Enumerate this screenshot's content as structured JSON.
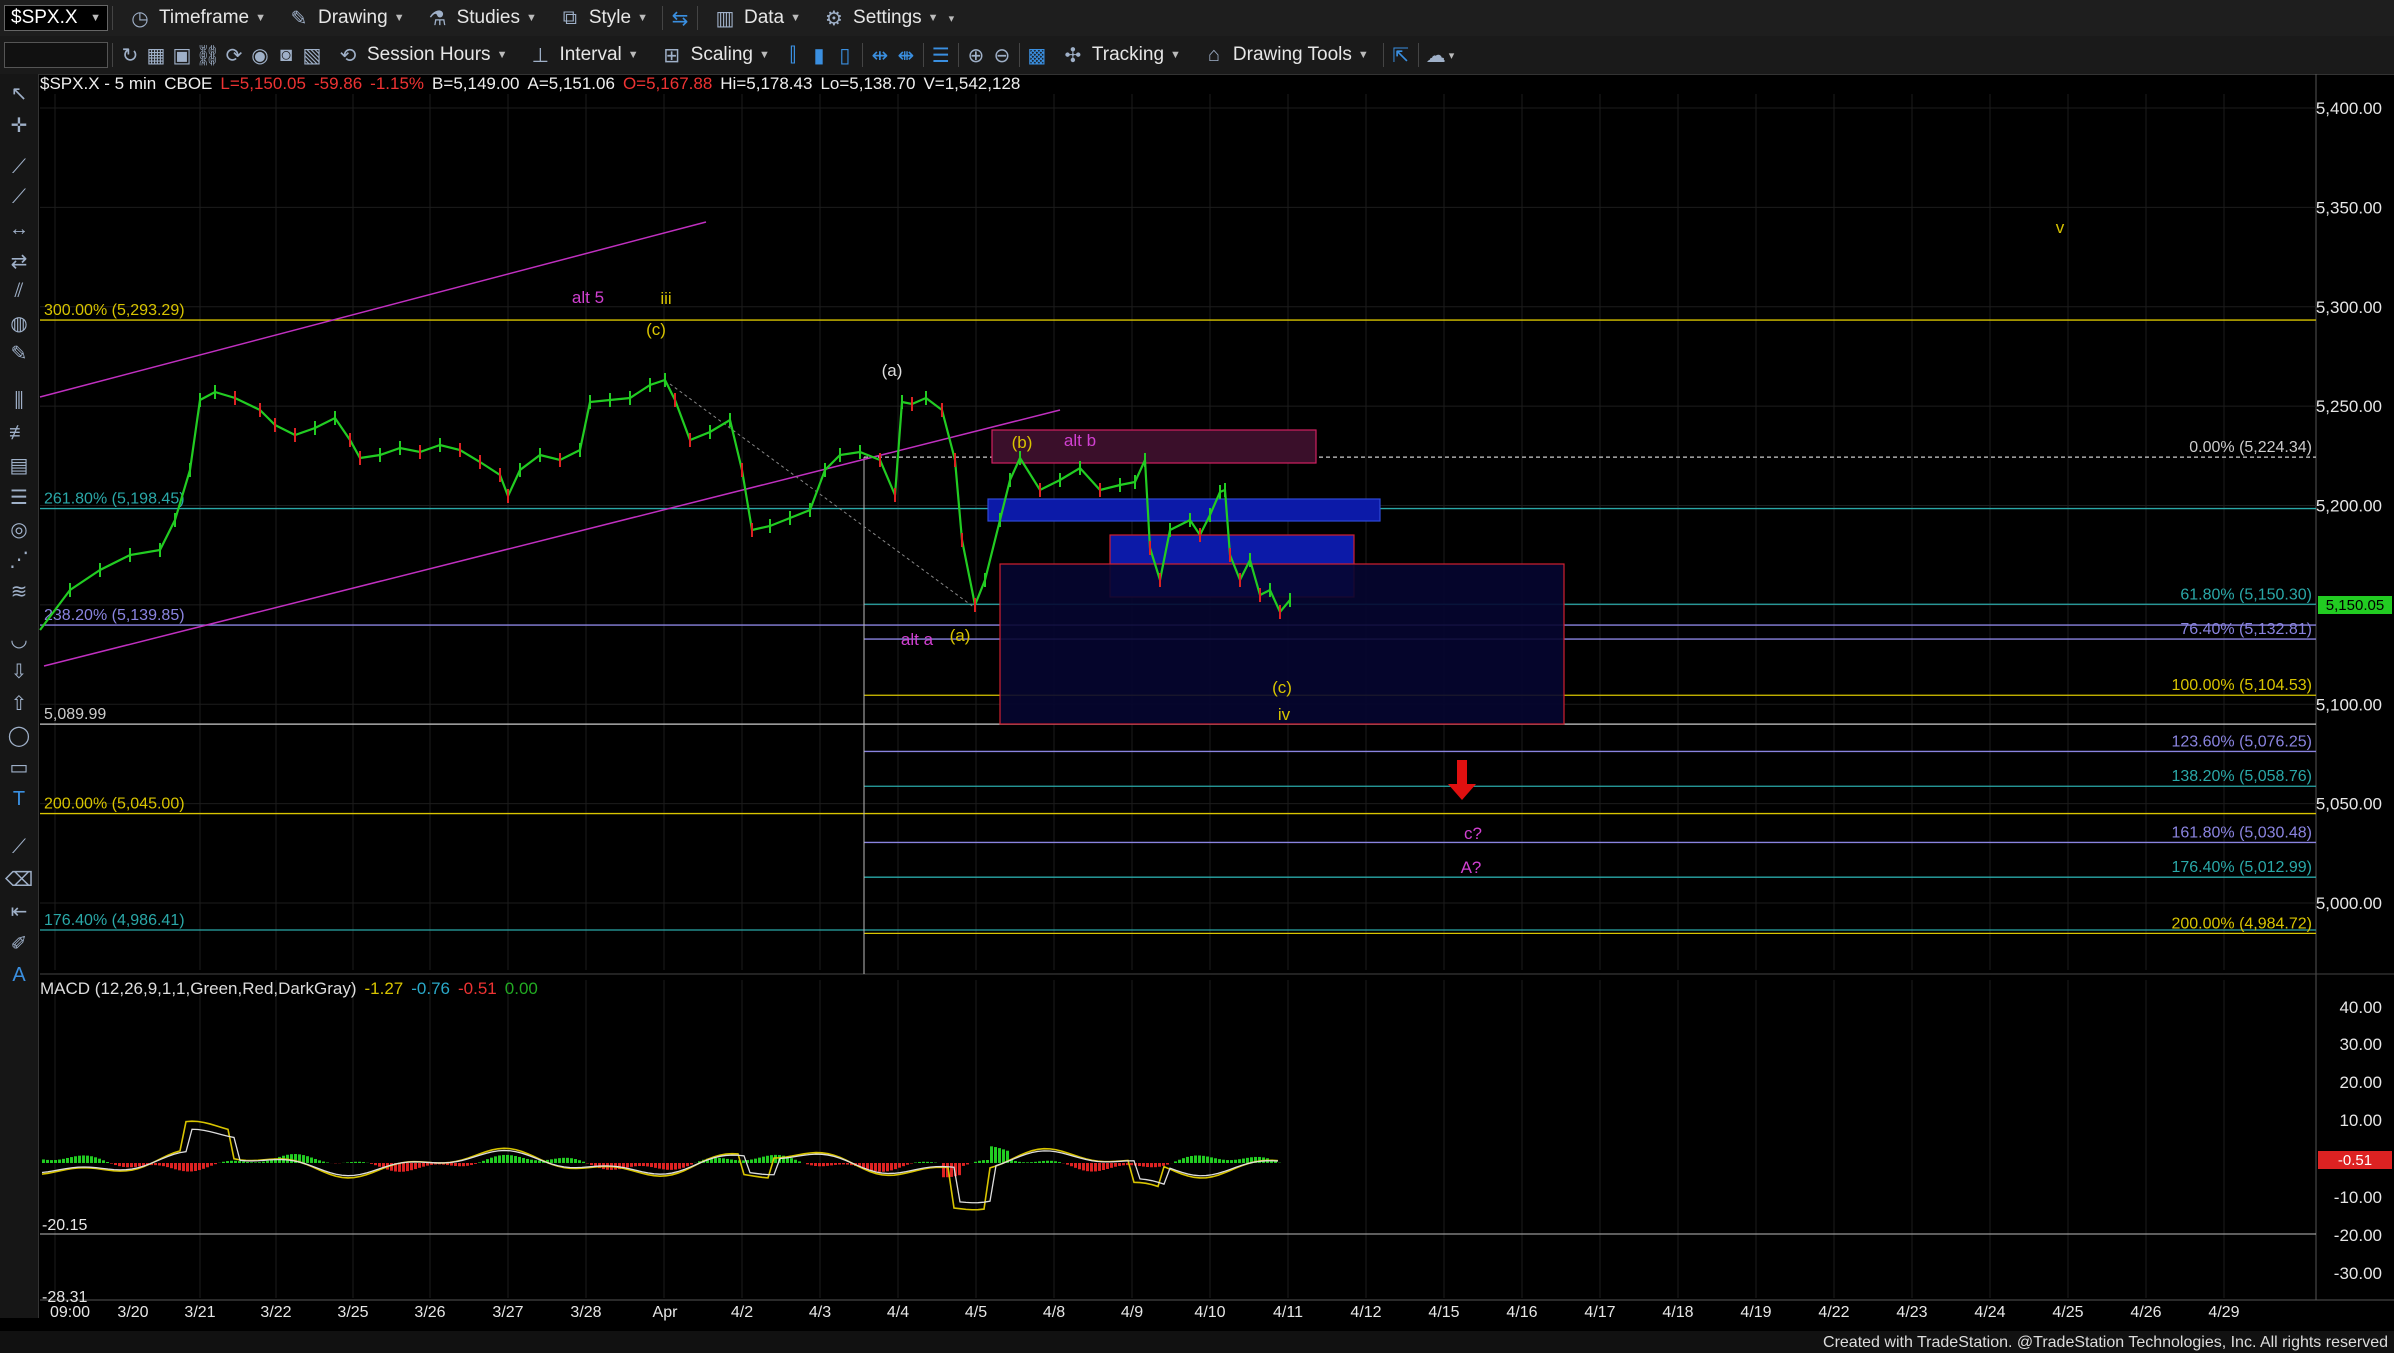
{
  "toolbar": {
    "symbol": "$SPX.X",
    "timeframe_label": "Timeframe",
    "drawing_label": "Drawing",
    "studies_label": "Studies",
    "style_label": "Style",
    "data_label": "Data",
    "settings_label": "Settings",
    "session_hours_label": "Session Hours",
    "interval_label": "Interval",
    "scaling_label": "Scaling",
    "tracking_label": "Tracking",
    "drawing_tools_label": "Drawing Tools"
  },
  "info": {
    "symbol_line": "$SPX.X - 5 min",
    "exchange": "CBOE",
    "last": "L=5,150.05",
    "change": "-59.86",
    "pct": "-1.15%",
    "bid": "B=5,149.00",
    "ask": "A=5,151.06",
    "open": "O=5,167.88",
    "high": "Hi=5,178.43",
    "low": "Lo=5,138.70",
    "volume": "V=1,542,128"
  },
  "macd": {
    "label": "MACD (12,26,9,1,1,Green,Red,DarkGray)",
    "v1": "-1.27",
    "v2": "-0.76",
    "v3": "-0.51",
    "v4": "0.00",
    "current_tag": "-0.51",
    "left_label_1": "-20.15",
    "left_label_2": "-28.31",
    "axis_ticks": [
      "40.00",
      "30.00",
      "20.00",
      "10.00",
      "-10.00",
      "-20.00",
      "-30.00"
    ]
  },
  "price_axis": {
    "ticks": [
      "5,400.00",
      "5,350.00",
      "5,300.00",
      "5,250.00",
      "5,200.00",
      "5,100.00",
      "5,050.00",
      "5,000.00"
    ],
    "current": "5,150.05"
  },
  "time_axis": [
    "09:00",
    "3/20",
    "3/21",
    "3/22",
    "3/25",
    "3/26",
    "3/27",
    "3/28",
    "Apr",
    "4/2",
    "4/3",
    "4/4",
    "4/5",
    "4/8",
    "4/9",
    "4/10",
    "4/11",
    "4/12",
    "4/15",
    "4/16",
    "4/17",
    "4/18",
    "4/19",
    "4/22",
    "4/23",
    "4/24",
    "4/25",
    "4/26",
    "4/29"
  ],
  "fib_levels": [
    {
      "label": "300.00% (5,293.29)",
      "color": "#d8c400"
    },
    {
      "label": "261.80% (5,198.45)",
      "color": "#2aa8a8"
    },
    {
      "label": "238.20% (5,139.85)",
      "color": "#8a84e0"
    },
    {
      "label": "5,089.99",
      "color": "#cccccc"
    },
    {
      "label": "200.00% (5,045.00)",
      "color": "#d8c400"
    },
    {
      "label": "176.40% (4,986.41)",
      "color": "#2aa8a8"
    },
    {
      "label": "0.00% (5,224.34)",
      "color": "#cccccc"
    },
    {
      "label": "61.80% (5,150.30)",
      "color": "#2aa8a8"
    },
    {
      "label": "76.40% (5,132.81)",
      "color": "#8a84e0"
    },
    {
      "label": "100.00% (5,104.53)",
      "color": "#d8c400"
    },
    {
      "label": "123.60% (5,076.25)",
      "color": "#8a84e0"
    },
    {
      "label": "138.20% (5,058.76)",
      "color": "#2aa8a8"
    },
    {
      "label": "161.80% (5,030.48)",
      "color": "#8a84e0"
    },
    {
      "label": "176.40% (5,012.99)",
      "color": "#2aa8a8"
    },
    {
      "label": "200.00% (4,984.72)",
      "color": "#d8c400"
    }
  ],
  "wave_labels": [
    {
      "text": "alt 5",
      "color": "#d040d0"
    },
    {
      "text": "iii",
      "color": "#d8c400"
    },
    {
      "text": "(c)",
      "color": "#d8c400"
    },
    {
      "text": "(a)",
      "color": "#dddddd"
    },
    {
      "text": "(b)",
      "color": "#d8c400"
    },
    {
      "text": "alt b",
      "color": "#d040d0"
    },
    {
      "text": "alt a",
      "color": "#d040d0"
    },
    {
      "text": "(a)",
      "color": "#d8c400"
    },
    {
      "text": "(c)",
      "color": "#d8c400"
    },
    {
      "text": "iv",
      "color": "#d8c400"
    },
    {
      "text": "c?",
      "color": "#d040d0"
    },
    {
      "text": "A?",
      "color": "#d040d0"
    },
    {
      "text": "v",
      "color": "#d8c400"
    }
  ],
  "colors": {
    "up": "#22cc22",
    "down": "#dd2222",
    "magenta": "#c030c0",
    "yellow": "#d8c400",
    "teal": "#2aa8a8",
    "purple": "#8a84e0",
    "current_price_tag": "#22cc22",
    "macd_tag": "#dd2222"
  },
  "footer": {
    "credit": "Created with TradeStation. @TradeStation Technologies, Inc. All rights reserved"
  }
}
